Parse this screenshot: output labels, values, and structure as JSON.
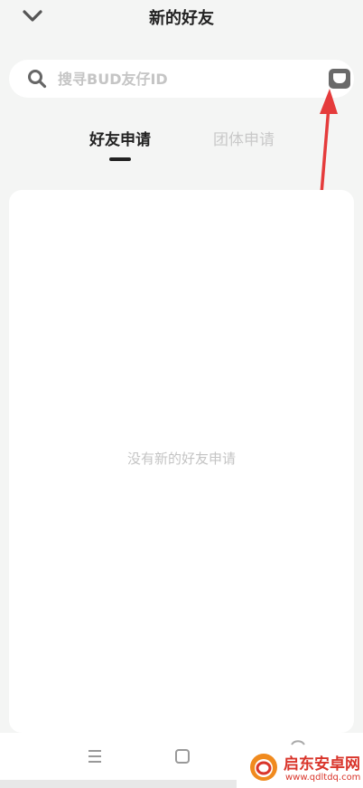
{
  "header": {
    "title": "新的好友"
  },
  "search": {
    "placeholder": "搜寻BUD友仔ID",
    "value": ""
  },
  "tabs": [
    {
      "label": "好友申请",
      "active": true
    },
    {
      "label": "团体申请",
      "active": false
    }
  ],
  "content": {
    "empty_message": "没有新的好友申请"
  },
  "watermark": {
    "name": "启东安卓网",
    "url": "www.qdltdq.com"
  },
  "colors": {
    "accent": "#222222",
    "annotation": "#e53b3b",
    "watermark": "#d9352b"
  },
  "icons": [
    "chevron-down-icon",
    "search-icon",
    "scan-icon",
    "menu-icon",
    "home-icon",
    "back-icon"
  ]
}
